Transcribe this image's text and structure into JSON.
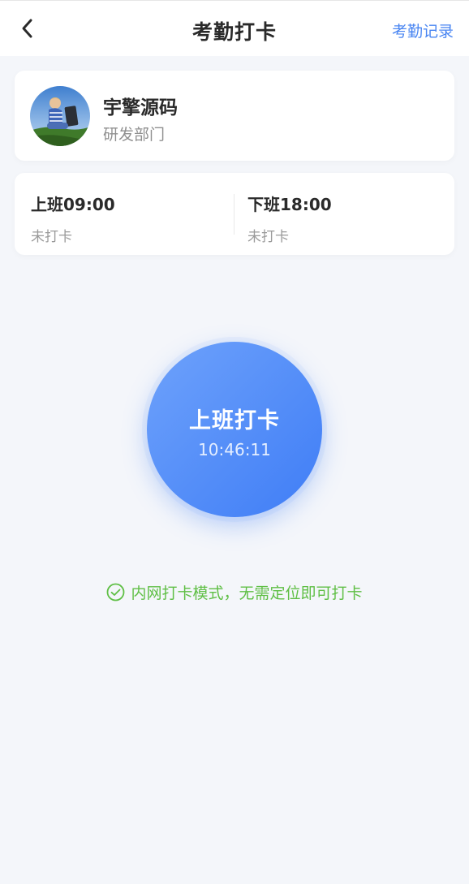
{
  "header": {
    "title": "考勤打卡",
    "back_icon": "chevron-left-icon",
    "link_label": "考勤记录",
    "link_color": "#4a86f2"
  },
  "profile": {
    "name": "宇擎源码",
    "department": "研发部门"
  },
  "shifts": {
    "on": {
      "title": "上班09:00",
      "status": "未打卡"
    },
    "off": {
      "title": "下班18:00",
      "status": "未打卡"
    }
  },
  "punch": {
    "label": "上班打卡",
    "time": "10:46:11",
    "color": "#4a86f2"
  },
  "hint": {
    "icon": "check-circle-icon",
    "text": "内网打卡模式，无需定位即可打卡",
    "color": "#5fbf45"
  }
}
